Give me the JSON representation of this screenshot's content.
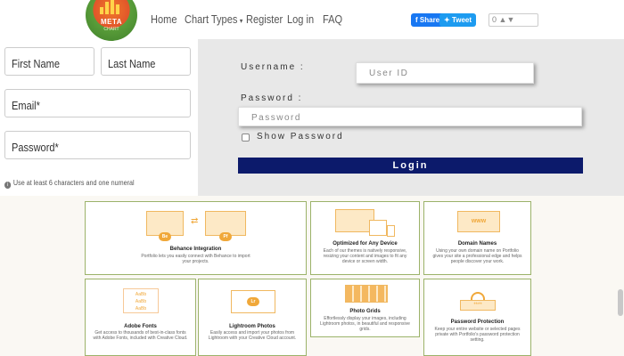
{
  "nav": {
    "logo_text": "META",
    "logo_sub": "CHART",
    "items": [
      "Home",
      "Chart Types",
      "Register",
      "Log in",
      "FAQ"
    ],
    "share_label": "Share",
    "tweet_label": "Tweet",
    "vote_text": "0"
  },
  "signup": {
    "first_name": "First Name",
    "last_name": "Last Name",
    "email": "Email*",
    "password": "Password*",
    "hint": "Use at least 6 characters and one numeral"
  },
  "login": {
    "username_label": "Username :",
    "username_placeholder": "User ID",
    "password_label": "Password :",
    "password_placeholder": "Password",
    "show_password": "Show Password",
    "login_button": "Login"
  },
  "features": [
    {
      "title": "Behance Integration",
      "desc": "Portfolio lets you easily connect with Behance to import your projects."
    },
    {
      "title": "Optimized for Any Device",
      "desc": "Each of our themes is natively responsive, resizing your content and images to fit any device or screen width."
    },
    {
      "title": "Domain Names",
      "desc": "Using your own domain name on Portfolio gives your site a professional edge and helps people discover your work."
    },
    {
      "title": "Adobe Fonts",
      "desc": "Get access to thousands of best-in-class fonts with Adobe Fonts, included with Creative Cloud."
    },
    {
      "title": "Lightroom Photos",
      "desc": "Easily access and import your photos from Lightroom with your Creative Cloud account."
    },
    {
      "title": "Photo Grids",
      "desc": "Effortlessly display your images, including Lightroom photos, in beautiful and responsive grids."
    },
    {
      "title": "Password Protection",
      "desc": "Keep your entire website or selected pages private with Portfolio's password protection setting."
    }
  ],
  "feature_badges": {
    "be": "Be",
    "pf": "Pf",
    "lr": "Lr",
    "www": "www",
    "fonts": [
      "AaBb",
      "AaBb",
      "AaBb"
    ],
    "pw": "****"
  },
  "colors": {
    "login_button": "#0c1a6b",
    "card_border": "#9cb36a",
    "accent_orange": "#f0a83a"
  }
}
